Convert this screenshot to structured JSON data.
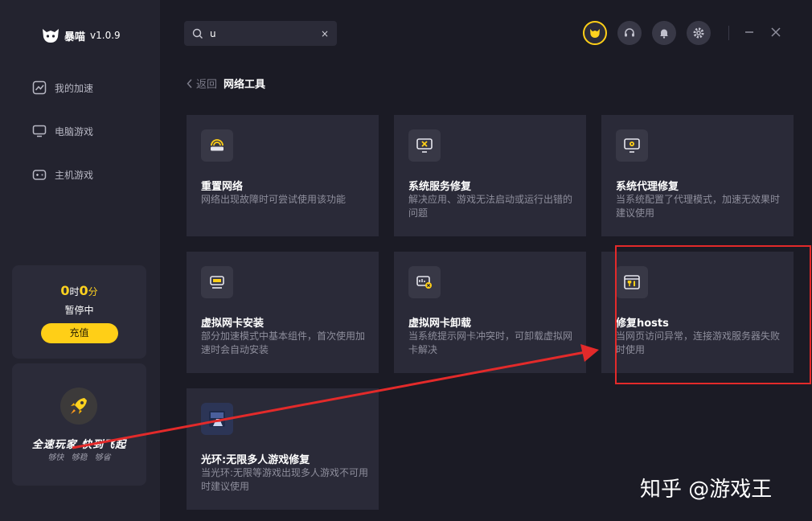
{
  "app": {
    "name": "暴喵",
    "version": "v1.0.9"
  },
  "sidebar": {
    "items": [
      {
        "label": "我的加速"
      },
      {
        "label": "电脑游戏"
      },
      {
        "label": "主机游戏"
      }
    ],
    "time": {
      "hours": "0",
      "hours_unit": "时",
      "minutes": "0",
      "minutes_unit": "分",
      "status": "暂停中",
      "recharge_label": "充值"
    },
    "promo": {
      "title": "全速玩家 快到飞起",
      "sub": "够快 够稳 够省"
    }
  },
  "search": {
    "value": "u",
    "clear": "×"
  },
  "breadcrumb": {
    "back": "返回",
    "title": "网络工具"
  },
  "cards": [
    {
      "title": "重置网络",
      "desc": "网络出现故障时可尝试使用该功能"
    },
    {
      "title": "系统服务修复",
      "desc": "解决应用、游戏无法启动或运行出错的问题"
    },
    {
      "title": "系统代理修复",
      "desc": "当系统配置了代理模式，加速无效果时建议使用"
    },
    {
      "title": "虚拟网卡安装",
      "desc": "部分加速模式中基本组件，首次使用加速时会自动安装"
    },
    {
      "title": "虚拟网卡卸载",
      "desc": "当系统提示网卡冲突时，可卸载虚拟网卡解决"
    },
    {
      "title": "修复hosts",
      "desc": "当网页访问异常，连接游戏服务器失败时使用"
    },
    {
      "title": "光环:无限多人游戏修复",
      "desc": "当光环:无限等游戏出现多人游戏不可用时建议使用"
    }
  ],
  "watermark": "知乎 @游戏王",
  "colors": {
    "accent": "#ffcf17",
    "highlight": "#e32a2a"
  }
}
